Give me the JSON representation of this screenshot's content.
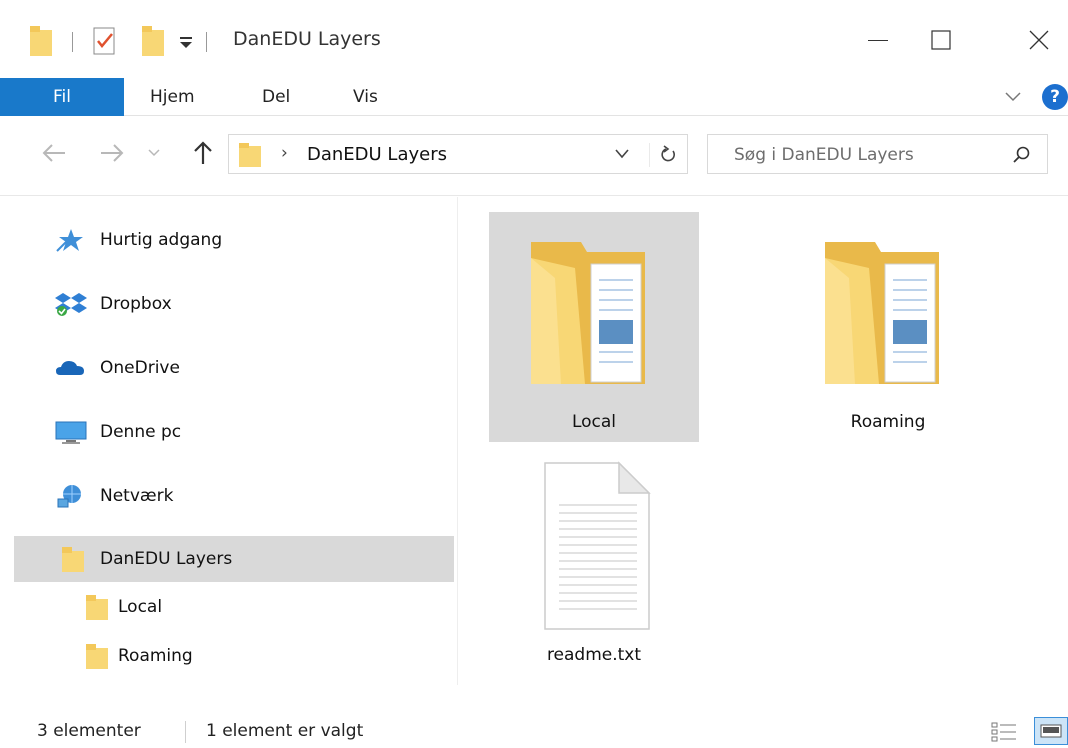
{
  "window": {
    "title": "DanEDU Layers"
  },
  "ribbon": {
    "tabs": [
      "Fil",
      "Hjem",
      "Del",
      "Vis"
    ],
    "help": "?"
  },
  "navbar": {
    "address_separator": "›",
    "address": "DanEDU Layers",
    "search_placeholder": "Søg i DanEDU Layers"
  },
  "navpane": {
    "items": [
      {
        "label": "Hurtig adgang",
        "icon": "star-pin-icon"
      },
      {
        "label": "Dropbox",
        "icon": "dropbox-icon"
      },
      {
        "label": "OneDrive",
        "icon": "onedrive-icon"
      },
      {
        "label": "Denne pc",
        "icon": "computer-icon"
      },
      {
        "label": "Netværk",
        "icon": "network-icon"
      },
      {
        "label": "DanEDU Layers",
        "icon": "folder-icon",
        "selected": true
      },
      {
        "label": "Local",
        "icon": "folder-icon"
      },
      {
        "label": "Roaming",
        "icon": "folder-icon"
      }
    ]
  },
  "content": {
    "items": [
      {
        "label": "Local",
        "type": "folder",
        "selected": true
      },
      {
        "label": "Roaming",
        "type": "folder",
        "selected": false
      },
      {
        "label": "readme.txt",
        "type": "text-file",
        "selected": false
      }
    ]
  },
  "status": {
    "count": "3 elementer",
    "selection": "1 element er valgt"
  },
  "colors": {
    "accent": "#1979ca",
    "selection": "#d9d9d9",
    "folder": "#f8d775"
  }
}
